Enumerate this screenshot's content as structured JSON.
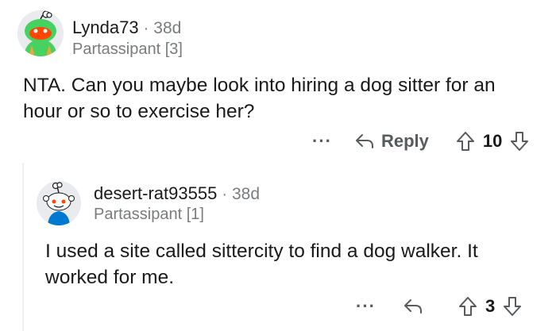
{
  "comment1": {
    "username": "Lynda73",
    "separator": "·",
    "age": "38d",
    "flair": "Partassipant [3]",
    "body_line1": "NTA. Can you maybe look into hiring a dog sitter for an",
    "body_line2": "hour or so to exercise her?",
    "more_label": "···",
    "reply_label": "Reply",
    "votes": "10"
  },
  "comment2": {
    "username": "desert-rat93555",
    "separator": "·",
    "age": "38d",
    "flair": "Partassipant [1]",
    "body_line1": "I used a site called sittercity to find a dog walker. It",
    "body_line2": "worked for me.",
    "more_label": "···",
    "votes": "3"
  },
  "colors": {
    "text": "#1a1a1b",
    "meta": "#787c7e",
    "actions": "#575b5e",
    "avatar_bg": "#e9ebee",
    "snoo_red": "#ff4500",
    "snoo_green": "#46d160",
    "snoo_blue": "#0079d3"
  },
  "icons": [
    "avatar-lynda73",
    "avatar-desert-rat93555",
    "reply-arrow-icon",
    "upvote-icon",
    "downvote-icon",
    "more-options-icon"
  ]
}
